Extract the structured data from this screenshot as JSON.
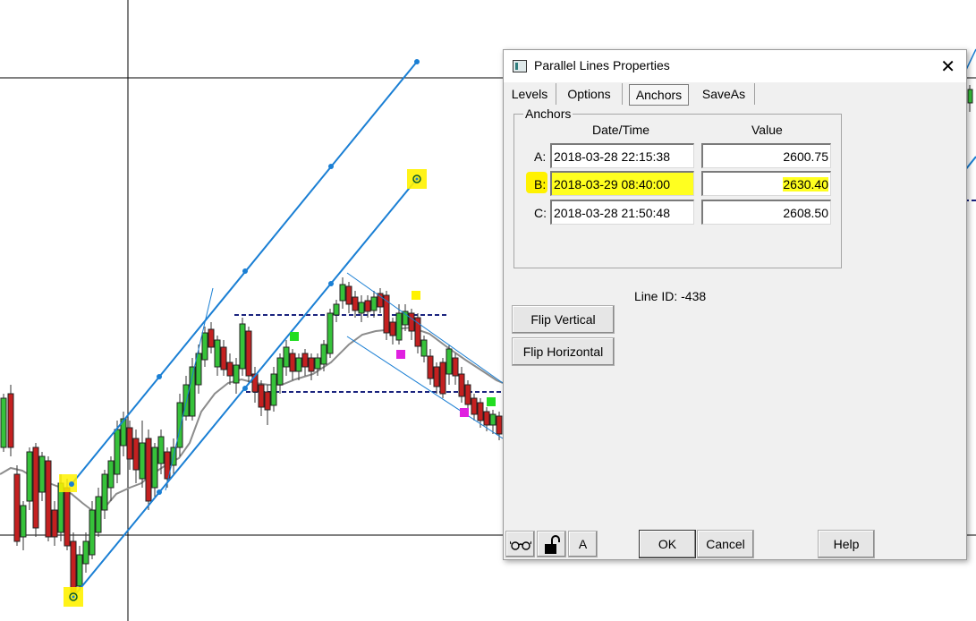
{
  "dialog": {
    "title": "Parallel Lines Properties",
    "close_glyph": "✕",
    "tabs": [
      {
        "label": "Levels"
      },
      {
        "label": "Options"
      },
      {
        "label": "Anchors",
        "active": true
      },
      {
        "label": "SaveAs"
      }
    ],
    "anchors": {
      "group_label": "Anchors",
      "col_datetime": "Date/Time",
      "col_value": "Value",
      "rows": [
        {
          "label": "A:",
          "datetime": "2018-03-28  22:15:38",
          "value": "2600.75"
        },
        {
          "label": "B:",
          "datetime": "2018-03-29  08:40:00",
          "value": "2630.40",
          "highlighted": true
        },
        {
          "label": "C:",
          "datetime": "2018-03-28  21:50:48",
          "value": "2608.50"
        }
      ]
    },
    "line_id": "Line ID: -438",
    "buttons": {
      "flip_vertical": "Flip Vertical",
      "flip_horizontal": "Flip Horizontal",
      "glasses_icon": "glasses-icon",
      "lock_icon": "unlock-icon",
      "a_label": "A",
      "ok": "OK",
      "cancel": "Cancel",
      "help": "Help"
    },
    "highlight_color": "#ffff20"
  },
  "chart_colors": {
    "channel_line": "#1a7fd4",
    "up_candle": "#36c23a",
    "down_candle": "#c42020",
    "moving_average": "#8c8c8c",
    "level_line": "#1a237e",
    "anchor_highlight": "#fff200"
  }
}
